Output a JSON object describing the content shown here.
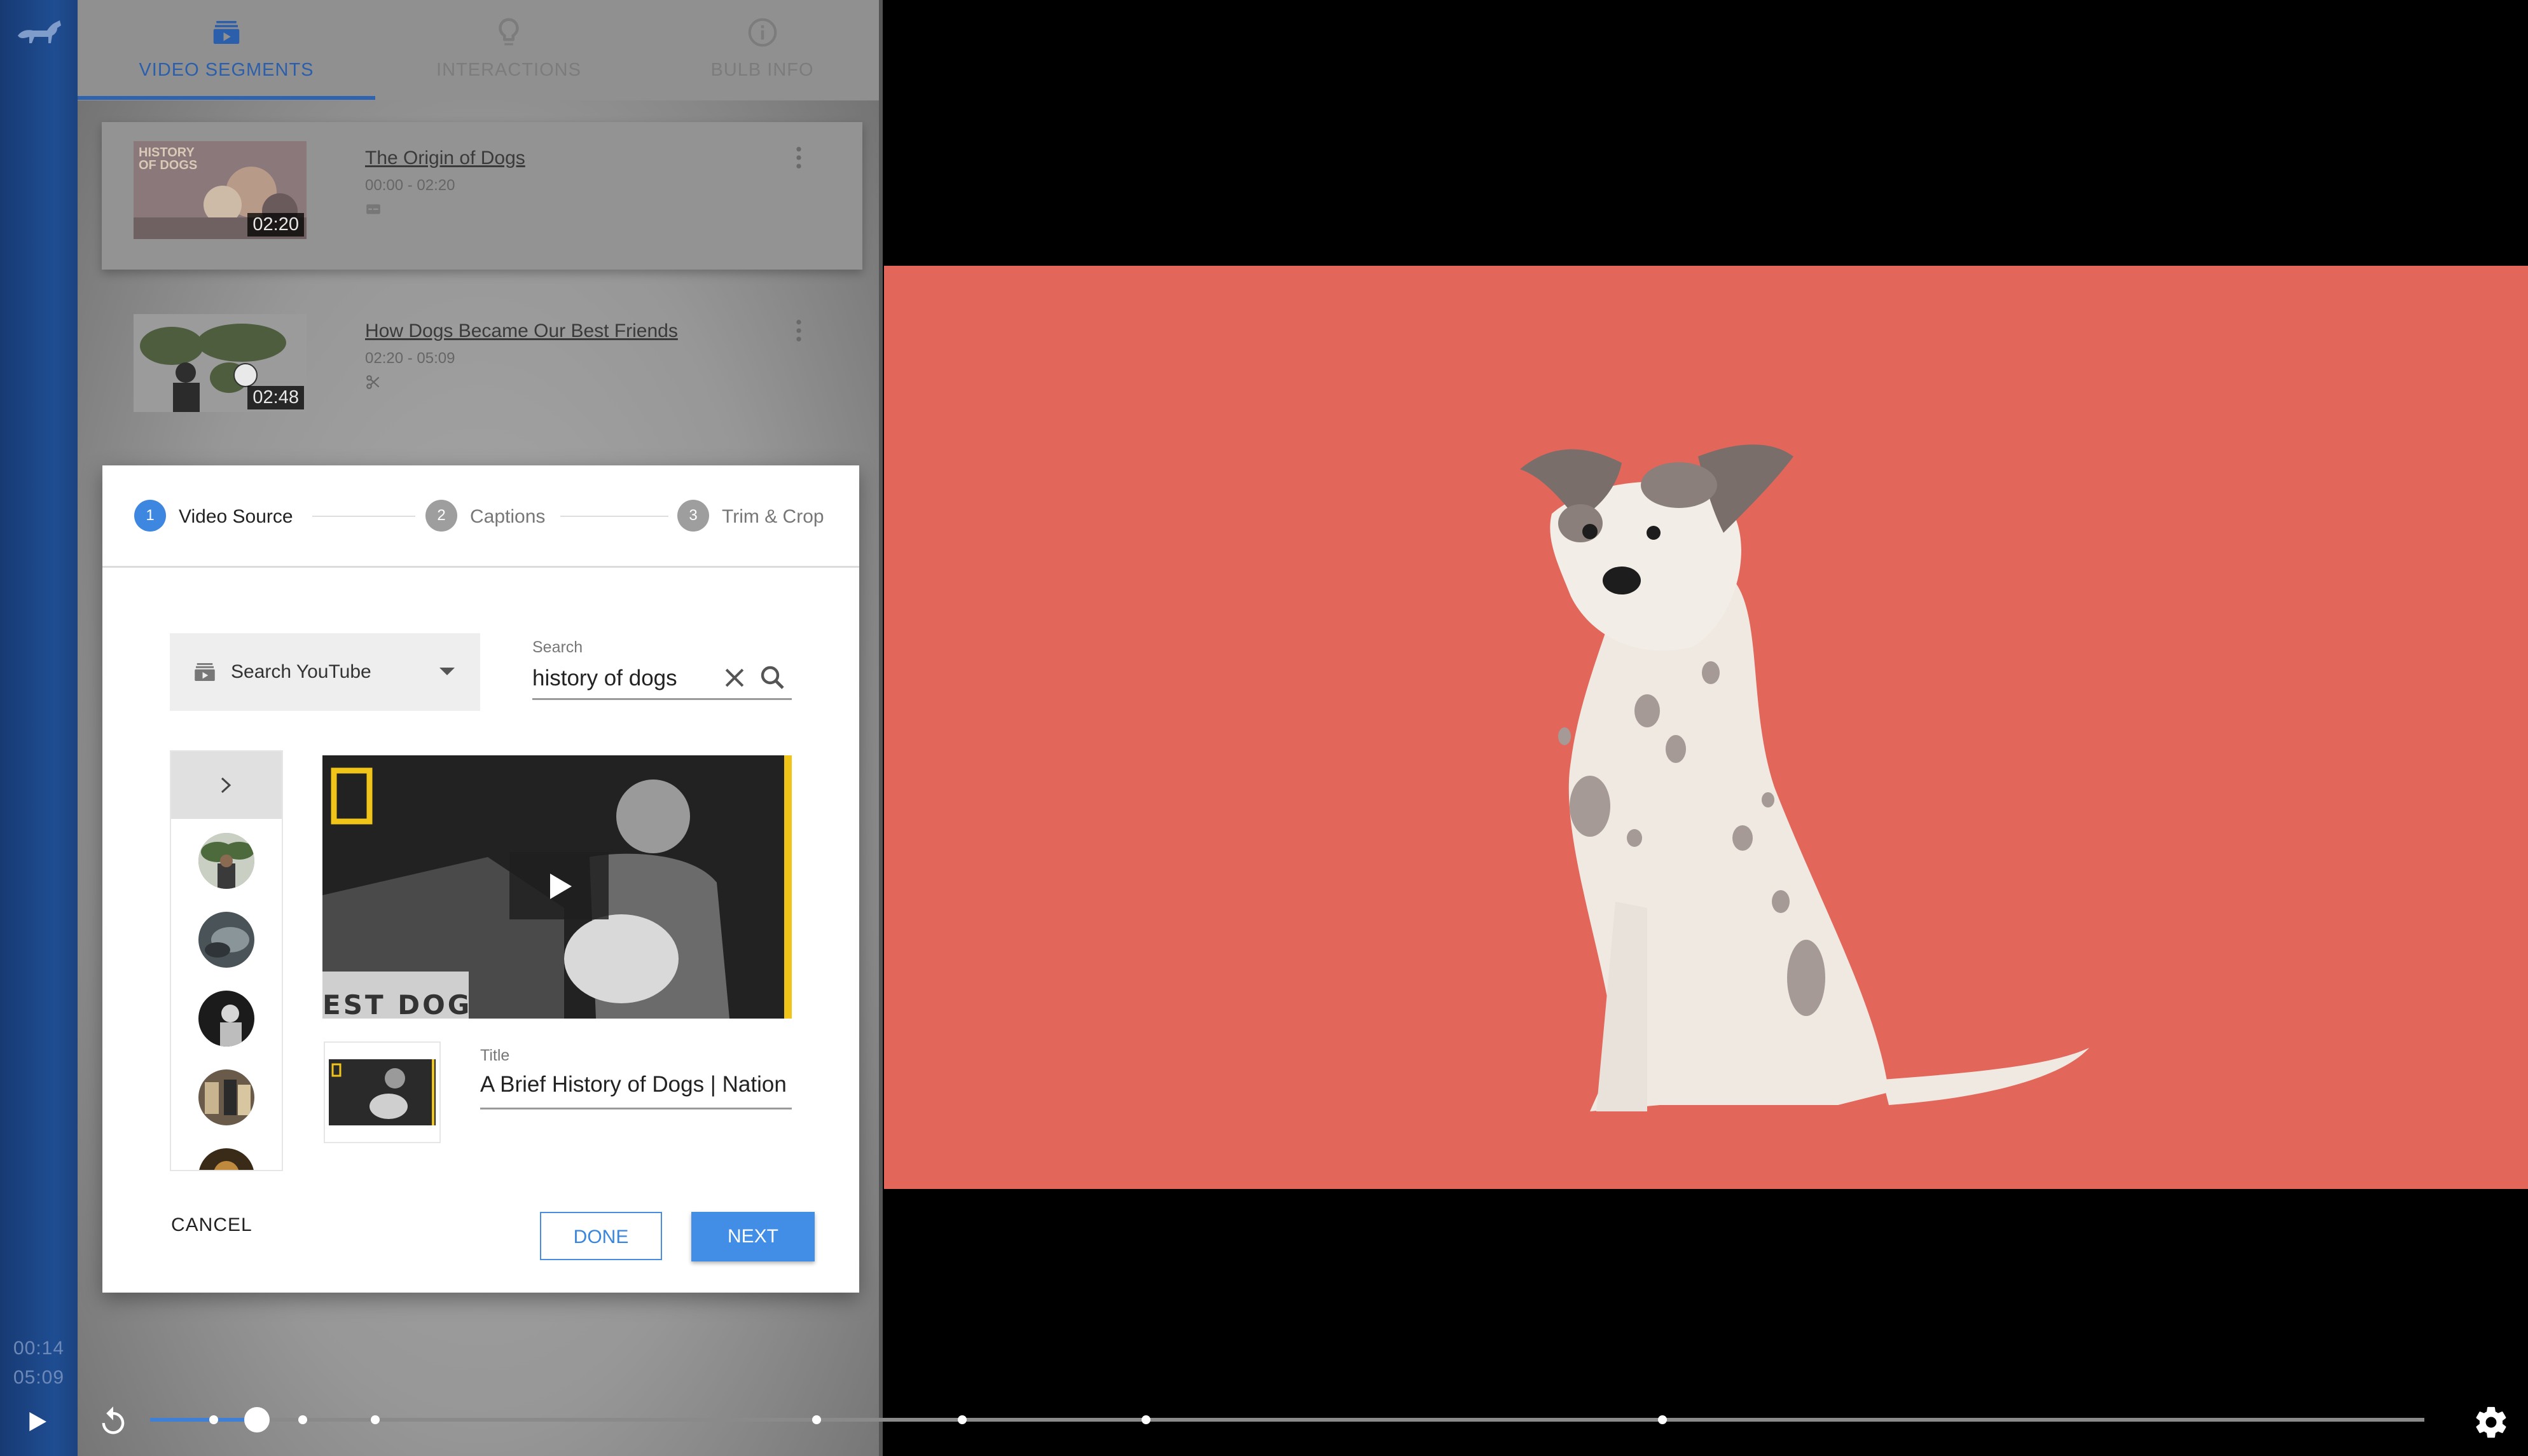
{
  "rail": {
    "current_time": "00:14",
    "total_time": "05:09"
  },
  "tabs": [
    {
      "label": "VIDEO SEGMENTS",
      "icon": "subscriptions-icon",
      "active": true
    },
    {
      "label": "INTERACTIONS",
      "icon": "lightbulb-icon",
      "active": false
    },
    {
      "label": "BULB INFO",
      "icon": "info-icon",
      "active": false
    }
  ],
  "segments": [
    {
      "title": "The Origin of Dogs",
      "range": "00:00 - 02:20",
      "duration": "02:20",
      "thumb_text": "HISTORY OF DOGS",
      "meta_icon": "captions-icon"
    },
    {
      "title": "How Dogs Became Our Best Friends",
      "range": "02:20 - 05:09",
      "duration": "02:48",
      "meta_icon": "scissors-icon"
    }
  ],
  "dialog": {
    "steps": [
      {
        "num": "1",
        "label": "Video Source",
        "active": true
      },
      {
        "num": "2",
        "label": "Captions",
        "active": false
      },
      {
        "num": "3",
        "label": "Trim & Crop",
        "active": false
      }
    ],
    "source_select": "Search YouTube",
    "search_caption": "Search",
    "search_value": "history of dogs",
    "preview_sign_text": "EST DOG",
    "title_caption": "Title",
    "title_value": "A Brief History of Dogs | Nation",
    "cancel_label": "CANCEL",
    "done_label": "DONE",
    "next_label": "NEXT"
  },
  "playback": {
    "progress": 0.047,
    "segment_markers": [
      0.028,
      0.067,
      0.099,
      0.293,
      0.357,
      0.438,
      0.665
    ]
  },
  "colors": {
    "accent": "#428de6",
    "video_background": "#e3665b",
    "rail": "#1f4d92"
  }
}
